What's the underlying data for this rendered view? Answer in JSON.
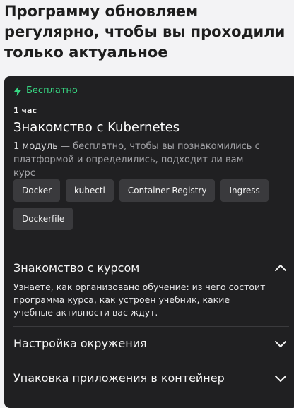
{
  "headline": "Программу обновляем регулярно, чтобы вы проходили только актуальное",
  "card": {
    "badge": "Бесплатно",
    "badge_icon": "lightning-icon",
    "duration": "1 час",
    "title": "Знакомство с Kubernetes",
    "description_lead": "1 модуль",
    "description_rest": " — бесплатно, чтобы вы познакомились с платформой и определились, подходит ли вам курс",
    "tags": [
      "Docker",
      "kubectl",
      "Container Registry",
      "Ingress",
      "Dockerfile"
    ],
    "sections": [
      {
        "title": "Знакомство с курсом",
        "expanded": true,
        "body": "Узнаете, как организовано обучение: из чего состоит программа курса, как устроен учебник, какие учебные активности вас ждут."
      },
      {
        "title": "Настройка окружения",
        "expanded": false
      },
      {
        "title": "Упаковка приложения в контейнер",
        "expanded": false
      }
    ]
  },
  "colors": {
    "card_bg": "#202022",
    "accent_green": "#37d682",
    "tag_bg": "#3a3a3d"
  }
}
